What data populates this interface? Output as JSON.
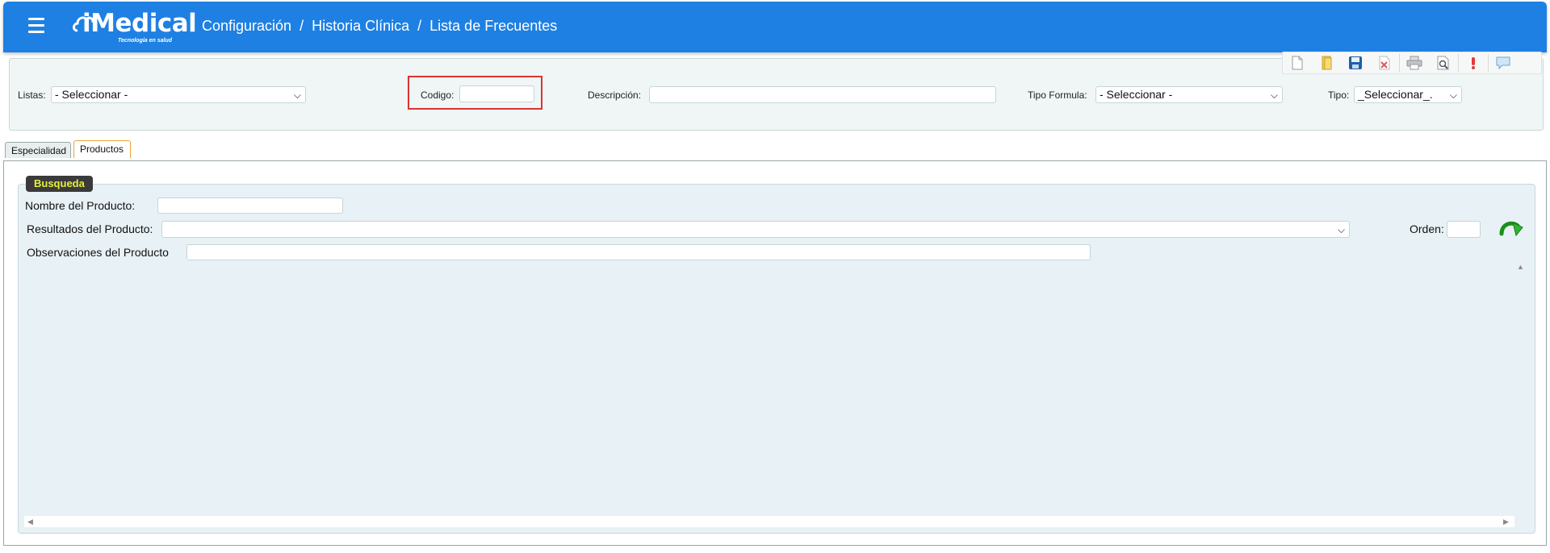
{
  "app": {
    "logo_text": "iMedical",
    "logo_tagline": "Tecnología en salud",
    "breadcrumb": [
      "Configuración",
      "Historia Clínica",
      "Lista de Frecuentes"
    ],
    "breadcrumb_separator": "/",
    "bar_color": "#1e80e3"
  },
  "toolbar": {
    "icons": [
      "new-document-icon",
      "open-folder-icon",
      "save-icon",
      "delete-icon",
      "print-icon",
      "print-preview-icon",
      "alert-icon",
      "comment-icon"
    ]
  },
  "filters": {
    "listas": {
      "label": "Listas:",
      "value": "- Seleccionar -"
    },
    "codigo": {
      "label": "Codigo:",
      "value": ""
    },
    "descripcion": {
      "label": "Descripción:",
      "value": ""
    },
    "tipo_formula": {
      "label": "Tipo Formula:",
      "value": "- Seleccionar -"
    },
    "tipo": {
      "label": "Tipo:",
      "value": "_Seleccionar_."
    }
  },
  "tabs": [
    {
      "label": "Especialidad",
      "active": false
    },
    {
      "label": "Productos",
      "active": true
    }
  ],
  "search": {
    "legend": "Busqueda",
    "nombre_label": "Nombre del Producto:",
    "nombre_value": "",
    "resultados_label": "Resultados del Producto:",
    "resultados_value": "",
    "orden_label": "Orden:",
    "orden_value": "",
    "observaciones_label": "Observaciones del Producto",
    "observaciones_value": ""
  },
  "colors": {
    "highlight_box": "#dd3333",
    "legend_bg": "#3a3a3a",
    "legend_text": "#e4f03a",
    "panel_bg": "#e8f1f5"
  }
}
